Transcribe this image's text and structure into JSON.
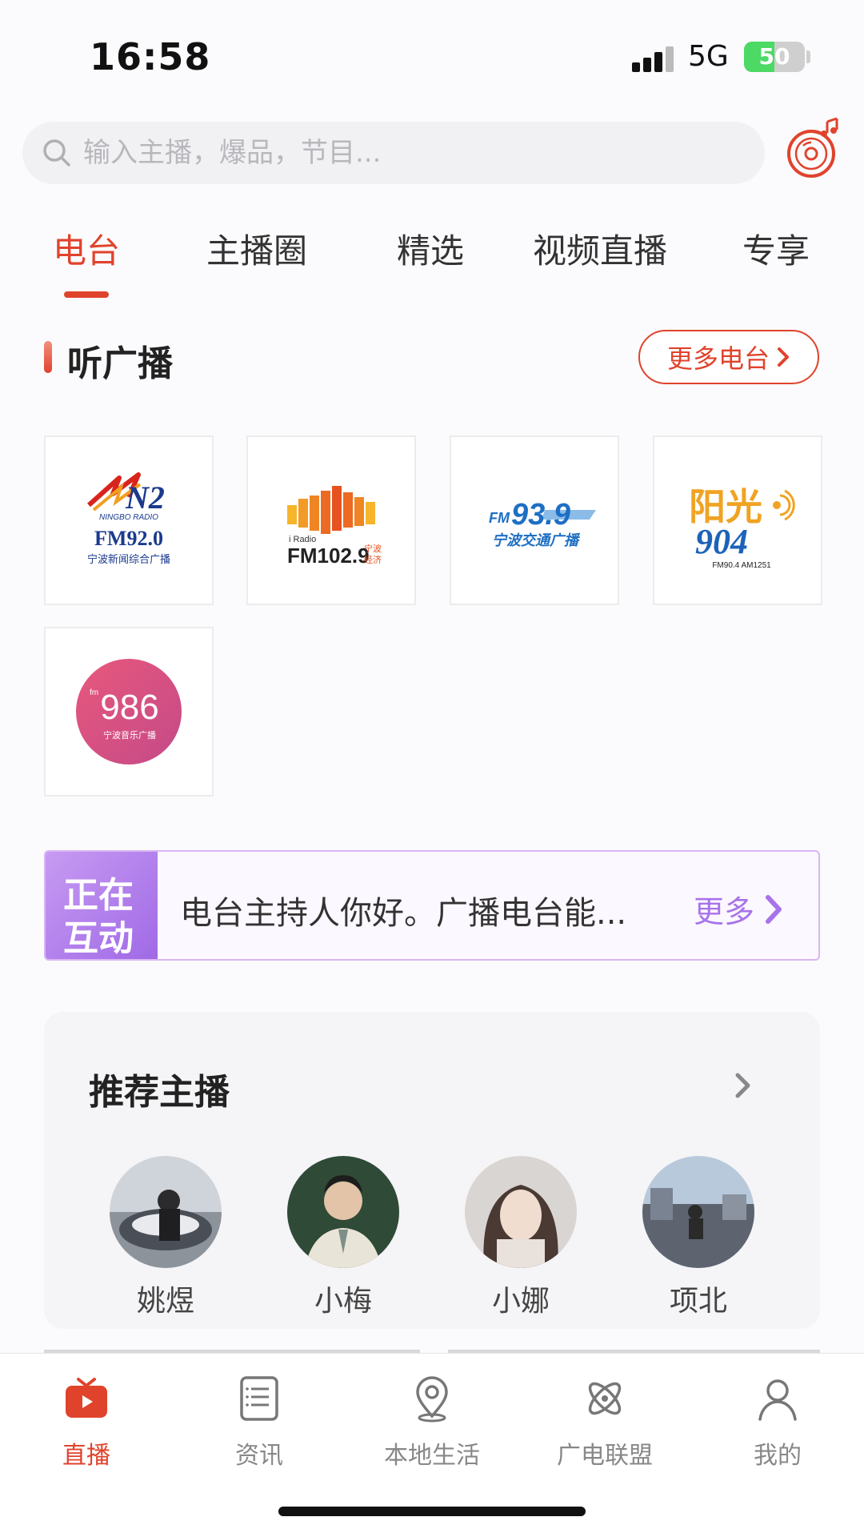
{
  "status_bar": {
    "time": "16:58",
    "network": "5G",
    "battery_level": "50"
  },
  "search": {
    "placeholder": "输入主播，爆品，节目..."
  },
  "tabs": [
    {
      "label": "电台",
      "active": true
    },
    {
      "label": "主播圈",
      "active": false
    },
    {
      "label": "精选",
      "active": false
    },
    {
      "label": "视频直播",
      "active": false
    },
    {
      "label": "专享",
      "active": false
    }
  ],
  "radio_section": {
    "title": "听广播",
    "more_label": "更多电台",
    "stations": [
      {
        "freq": "FM92.0",
        "name": "宁波新闻综合广播",
        "brand": "NINGBO RADIO"
      },
      {
        "freq": "FM102.9",
        "name": "宁波经济广播",
        "brand": "i Radio"
      },
      {
        "freq": "FM93.9",
        "name": "宁波交通广播"
      },
      {
        "brand": "阳光",
        "freq": "904",
        "sub": "FM90.4 AM1251"
      },
      {
        "freq": "986",
        "name": "宁波音乐广播",
        "prefix": "fm"
      }
    ]
  },
  "interaction": {
    "badge_line1": "正在",
    "badge_line2": "互动",
    "text": "电台主持人你好。广播电台能...",
    "more_label": "更多"
  },
  "recommended_hosts": {
    "title": "推荐主播",
    "hosts": [
      {
        "name": "姚煜"
      },
      {
        "name": "小梅"
      },
      {
        "name": "小娜"
      },
      {
        "name": "项北"
      }
    ]
  },
  "bottom_nav": [
    {
      "label": "直播",
      "icon": "live-tv-icon",
      "active": true
    },
    {
      "label": "资讯",
      "icon": "news-icon",
      "active": false
    },
    {
      "label": "本地生活",
      "icon": "location-pin-icon",
      "active": false
    },
    {
      "label": "广电联盟",
      "icon": "atom-icon",
      "active": false
    },
    {
      "label": "我的",
      "icon": "profile-icon",
      "active": false
    }
  ],
  "colors": {
    "accent": "#e0432c",
    "interaction_purple": "#a873ea"
  }
}
